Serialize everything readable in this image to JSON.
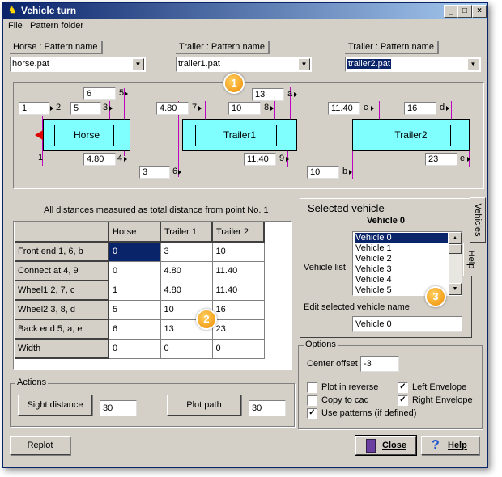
{
  "window": {
    "title": "Vehicle turn",
    "min_glyph": "_",
    "max_glyph": "□",
    "close_glyph": "×"
  },
  "menu": {
    "file": "File",
    "pattern_folder": "Pattern folder"
  },
  "patterns": {
    "horse": {
      "label": "Horse : Pattern name",
      "value": "horse.pat"
    },
    "trailer1": {
      "label": "Trailer : Pattern name",
      "value": "trailer1.pat"
    },
    "trailer2": {
      "label": "Trailer : Pattern name",
      "value": "trailer2.pat"
    }
  },
  "diagram": {
    "boxes": {
      "horse": "Horse",
      "trailer1": "Trailer1",
      "trailer2": "Trailer2"
    },
    "fields": {
      "h_back": "6",
      "h_front": "1",
      "h_wheel2": "5",
      "h_connect": "4.80",
      "h_wheel1": "3",
      "t1_connect": "4.80",
      "t1_wheel2": "10",
      "t1_back": "13",
      "t1_wheel1": "11.40",
      "t1_front": "3",
      "t2_connect": "11.40",
      "t2_back": "16",
      "t2_wheel1": "23",
      "t2_front": "10"
    },
    "marks": {
      "m1": "1",
      "m2": "2",
      "m3": "3",
      "m4": "4",
      "m5": "5",
      "m6": "6",
      "m7": "7",
      "m8": "8",
      "m9": "9",
      "ma": "a",
      "mb": "b",
      "mc": "c",
      "md": "d",
      "me": "e",
      "m1b": "1"
    }
  },
  "table": {
    "caption": "All distances measured as total distance from point No. 1",
    "headers": [
      "",
      "Horse",
      "Trailer 1",
      "Trailer 2"
    ],
    "rows": [
      [
        "Front end  1, 6, b",
        "0",
        "3",
        "10"
      ],
      [
        "Connect at    4, 9",
        "0",
        "4.80",
        "11.40"
      ],
      [
        "Wheel1     2, 7, c",
        "1",
        "4.80",
        "11.40"
      ],
      [
        "Wheel2    3, 8, d",
        "5",
        "10",
        "16"
      ],
      [
        "Back end   5, a, e",
        "6",
        "13",
        "23"
      ],
      [
        "Width",
        "0",
        "0",
        "0"
      ]
    ]
  },
  "actions": {
    "title": "Actions",
    "sight_label": "Sight distance",
    "sight_value": "30",
    "plot_label": "Plot path",
    "plot_value": "30"
  },
  "selected": {
    "title": "Selected vehicle",
    "name": "Vehicle 0",
    "list_label": "Vehicle list",
    "items": [
      "Vehicle 0",
      "Vehicle 1",
      "Vehicle 2",
      "Vehicle 3",
      "Vehicle 4",
      "Vehicle 5"
    ],
    "edit_label": "Edit selected vehicle name",
    "edit_value": "Vehicle 0",
    "tab_vehicles": "Vehicles",
    "tab_help": "Help"
  },
  "options": {
    "title": "Options",
    "center_label": "Center offset",
    "center_value": "-3",
    "plot_reverse": "Plot in reverse",
    "copy_cad": "Copy to cad",
    "use_patterns": "Use patterns (if defined)",
    "left_env": "Left Envelope",
    "right_env": "Right Envelope",
    "checked": {
      "plot_reverse": false,
      "copy_cad": false,
      "use_patterns": true,
      "left_env": true,
      "right_env": true
    }
  },
  "footer": {
    "replot": "Replot",
    "close": "Close",
    "help": "Help"
  },
  "callouts": {
    "c1": "1",
    "c2": "2",
    "c3": "3"
  },
  "colors": {
    "box_fill": "#80ffff",
    "title_bar": "#0a246a",
    "selection": "#0a246a",
    "callout": "#f08c00",
    "link_line": "#e00000",
    "tick_line": "#c000c0"
  },
  "icons": {
    "app": "truck-icon",
    "close": "door-icon",
    "help": "question-icon"
  }
}
